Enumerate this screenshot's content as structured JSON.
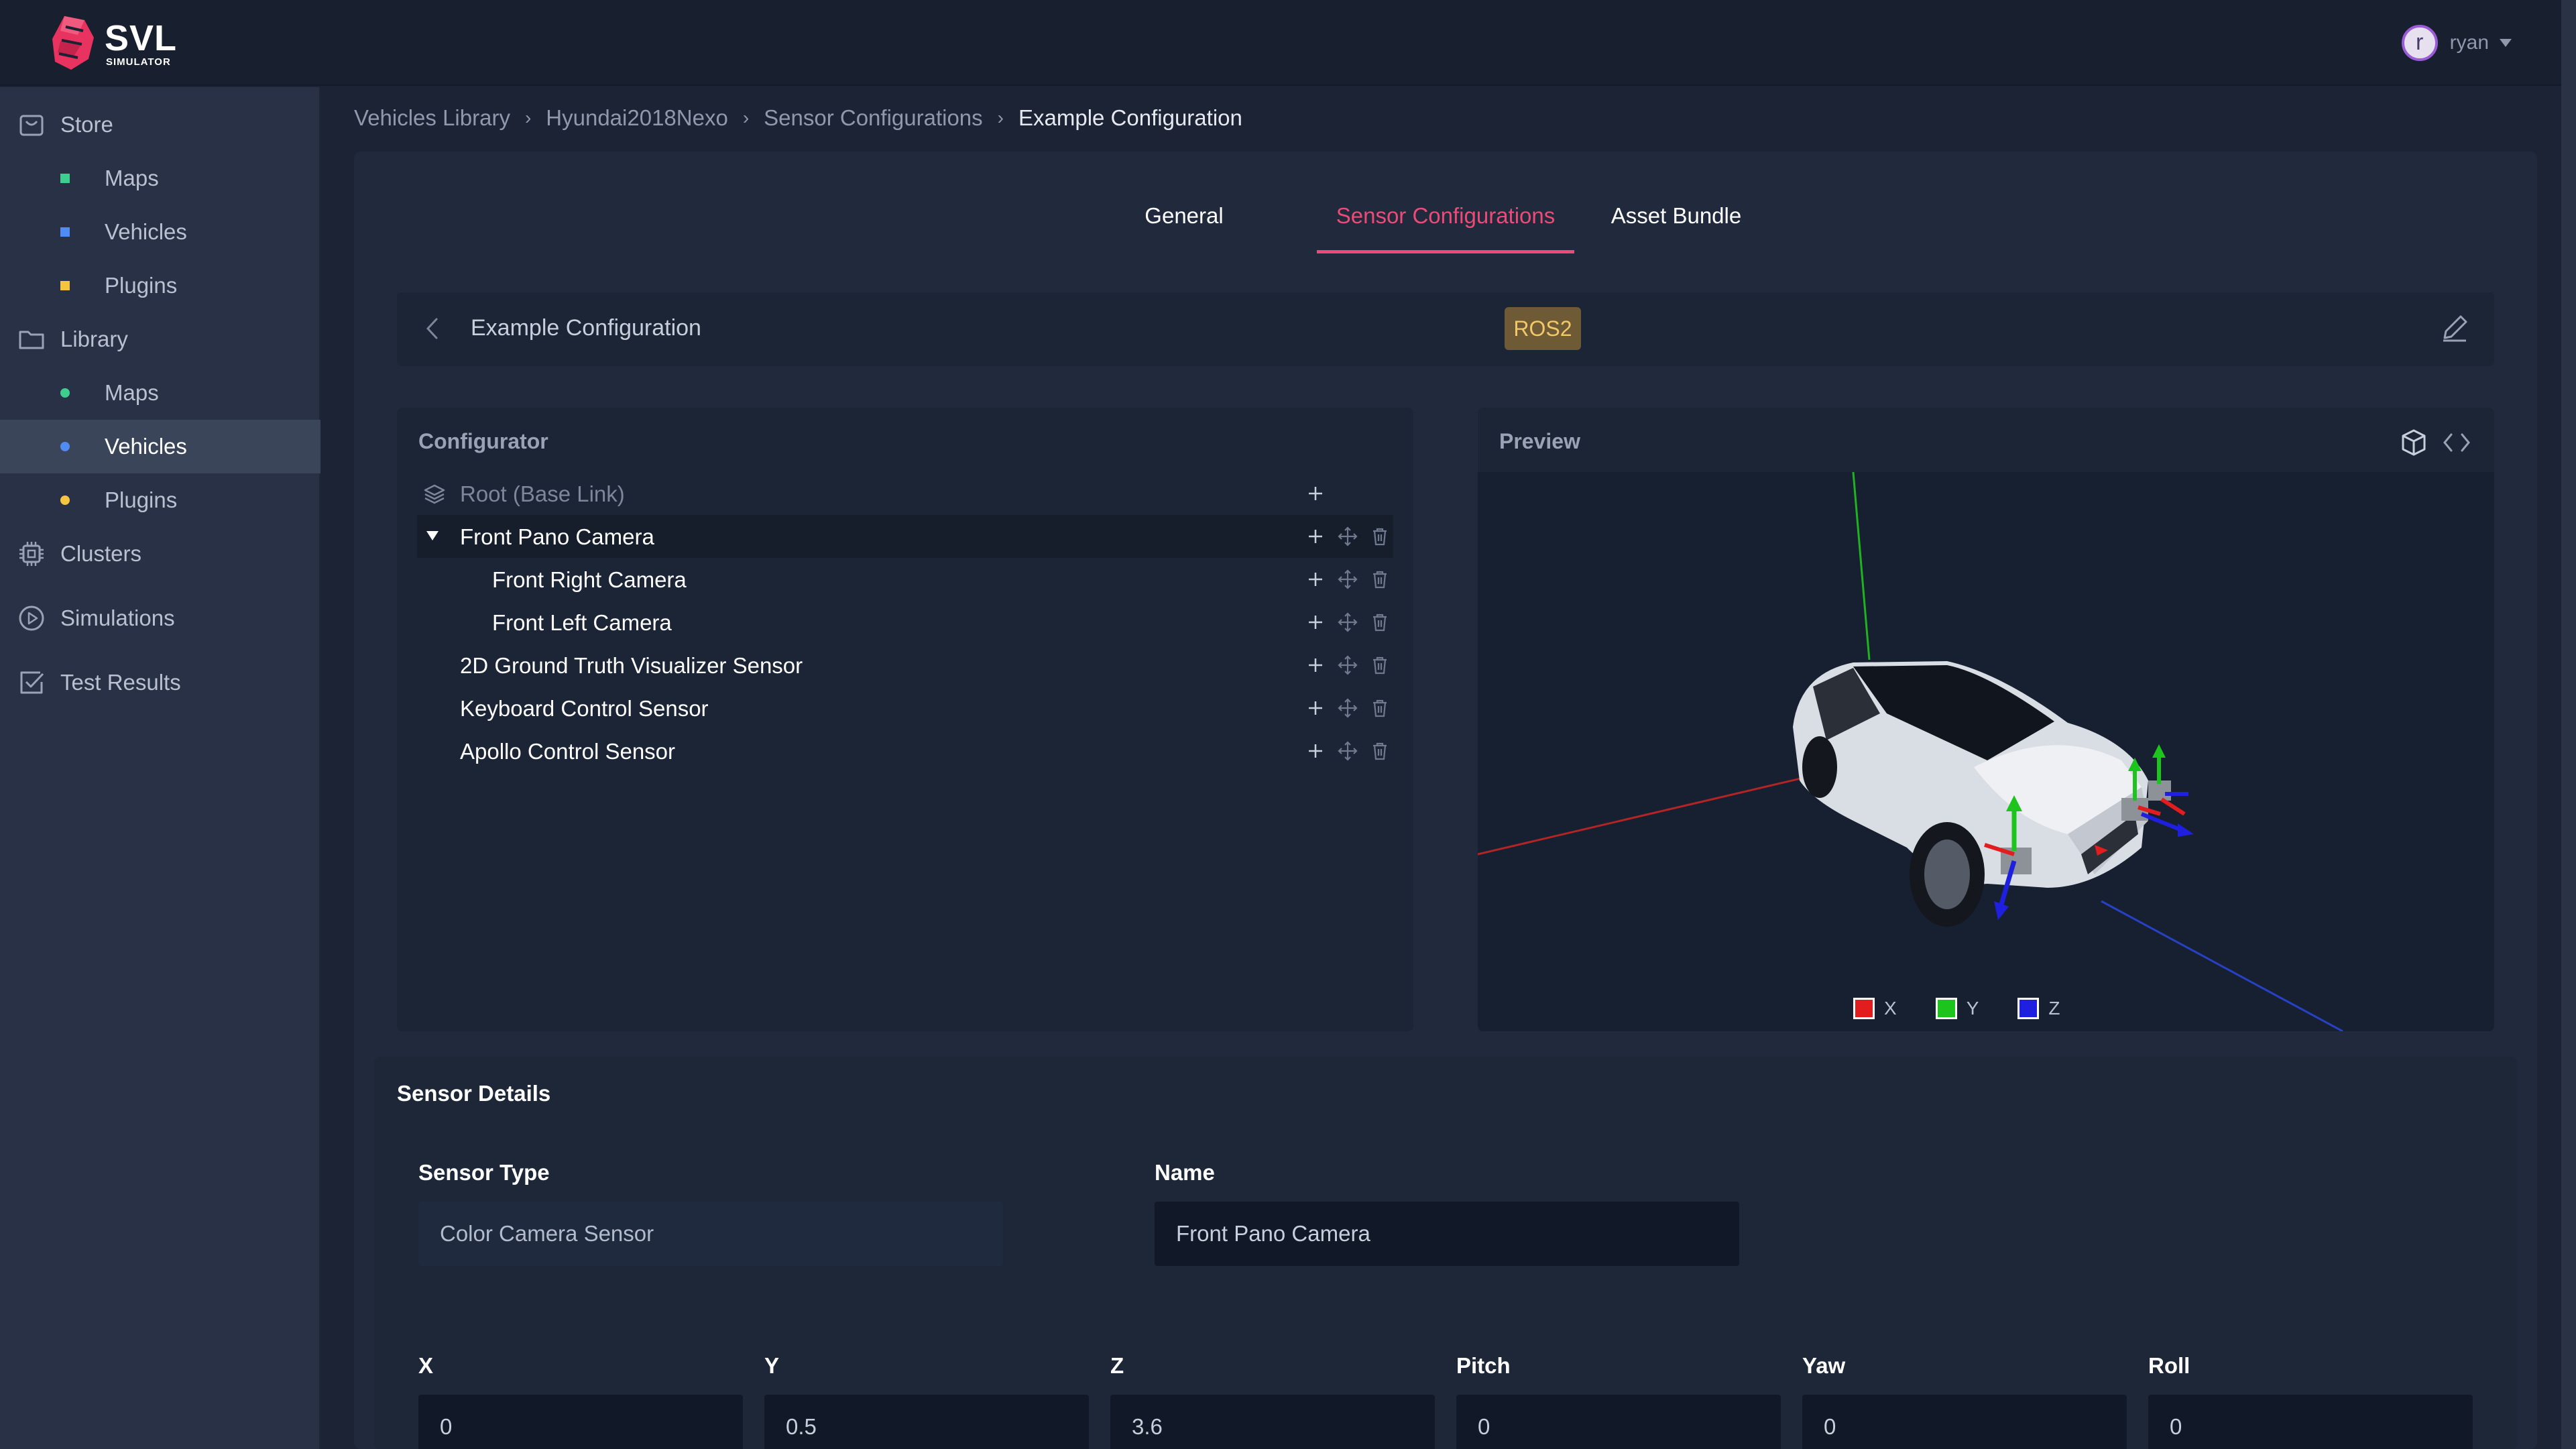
{
  "app": {
    "logo_title": "SVL",
    "logo_subtitle": "SIMULATOR",
    "user_initial": "r",
    "user_name": "ryan"
  },
  "sidebar": {
    "items": [
      {
        "label": "Store",
        "icon": "store-icon"
      },
      {
        "label": "Maps",
        "parent": "Store",
        "marker_color": "#3ecf8e"
      },
      {
        "label": "Vehicles",
        "parent": "Store",
        "marker_color": "#4f8df5"
      },
      {
        "label": "Plugins",
        "parent": "Store",
        "marker_color": "#f5c542"
      },
      {
        "label": "Library",
        "icon": "folder-icon"
      },
      {
        "label": "Maps",
        "parent": "Library",
        "marker_color": "#3ecf8e"
      },
      {
        "label": "Vehicles",
        "parent": "Library",
        "marker_color": "#4f8df5",
        "active": true
      },
      {
        "label": "Plugins",
        "parent": "Library",
        "marker_color": "#f5c542"
      },
      {
        "label": "Clusters",
        "icon": "chip-icon"
      },
      {
        "label": "Simulations",
        "icon": "play-icon"
      },
      {
        "label": "Test Results",
        "icon": "checklist-icon"
      }
    ]
  },
  "breadcrumb": [
    "Vehicles Library",
    "Hyundai2018Nexo",
    "Sensor Configurations",
    "Example Configuration"
  ],
  "tabs": [
    {
      "label": "General"
    },
    {
      "label": "Sensor Configurations",
      "active": true
    },
    {
      "label": "Asset Bundle"
    }
  ],
  "config": {
    "title": "Example Configuration",
    "bridge_badge": "ROS2"
  },
  "configurator": {
    "title": "Configurator",
    "tree": [
      {
        "label": "Root (Base Link)",
        "depth": 0,
        "root": true
      },
      {
        "label": "Front Pano Camera",
        "depth": 0,
        "expanded": true,
        "selected": true
      },
      {
        "label": "Front Right Camera",
        "depth": 1
      },
      {
        "label": "Front Left Camera",
        "depth": 1
      },
      {
        "label": "2D Ground Truth Visualizer Sensor",
        "depth": 0
      },
      {
        "label": "Keyboard Control Sensor",
        "depth": 0
      },
      {
        "label": "Apollo Control Sensor",
        "depth": 0
      }
    ]
  },
  "preview": {
    "title": "Preview",
    "legend": [
      {
        "label": "X",
        "color": "#e11d1d"
      },
      {
        "label": "Y",
        "color": "#1ec41e"
      },
      {
        "label": "Z",
        "color": "#1f1fe0"
      }
    ]
  },
  "details": {
    "title": "Sensor Details",
    "sensor_type_label": "Sensor Type",
    "sensor_type_value": "Color Camera Sensor",
    "name_label": "Name",
    "name_value": "Front Pano Camera",
    "transform": [
      {
        "label": "X",
        "value": "0"
      },
      {
        "label": "Y",
        "value": "0.5"
      },
      {
        "label": "Z",
        "value": "3.6"
      },
      {
        "label": "Pitch",
        "value": "0"
      },
      {
        "label": "Yaw",
        "value": "0"
      },
      {
        "label": "Roll",
        "value": "0"
      }
    ]
  }
}
